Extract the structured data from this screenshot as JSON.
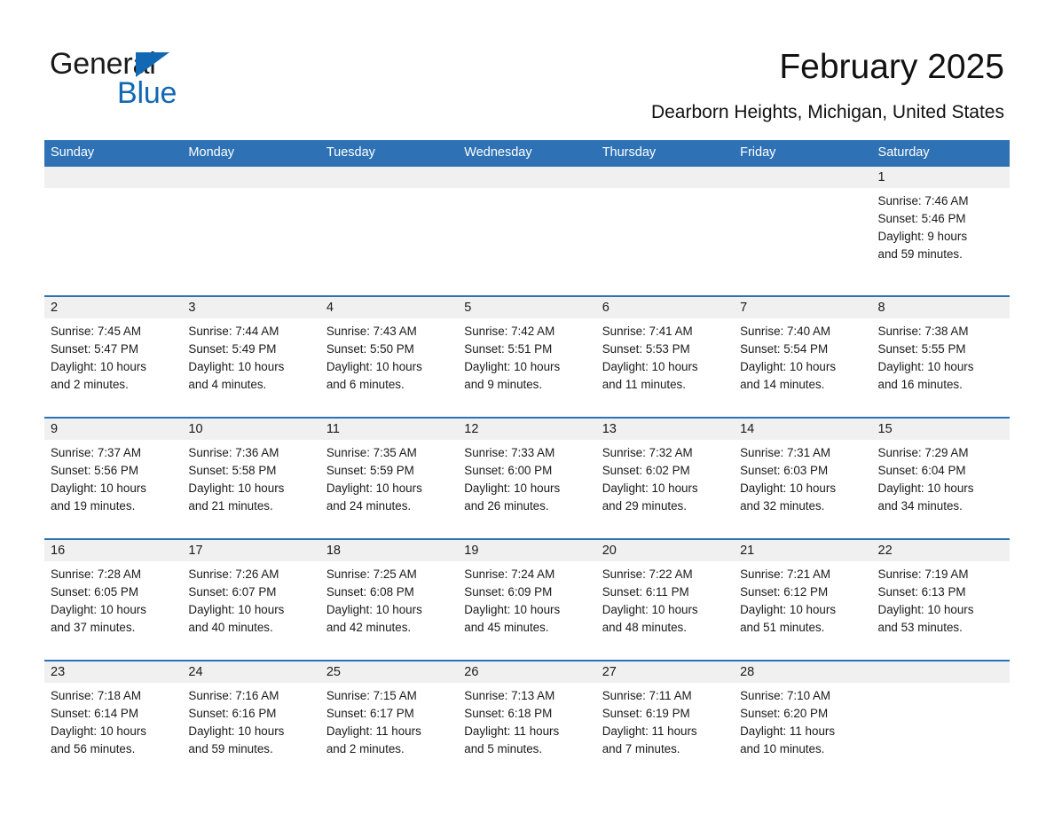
{
  "brand": {
    "name_part1": "General",
    "name_part2": "Blue",
    "triangle_color": "#1268b3"
  },
  "header": {
    "title": "February 2025",
    "subtitle": "Dearborn Heights, Michigan, United States",
    "accent_color": "#2e72b5",
    "band_color": "#f0f0f0"
  },
  "calendar": {
    "weekdays": [
      "Sunday",
      "Monday",
      "Tuesday",
      "Wednesday",
      "Thursday",
      "Friday",
      "Saturday"
    ],
    "weeks": [
      [
        {
          "day": "",
          "sunrise": "",
          "sunset": "",
          "daylight_line1": "",
          "daylight_line2": ""
        },
        {
          "day": "",
          "sunrise": "",
          "sunset": "",
          "daylight_line1": "",
          "daylight_line2": ""
        },
        {
          "day": "",
          "sunrise": "",
          "sunset": "",
          "daylight_line1": "",
          "daylight_line2": ""
        },
        {
          "day": "",
          "sunrise": "",
          "sunset": "",
          "daylight_line1": "",
          "daylight_line2": ""
        },
        {
          "day": "",
          "sunrise": "",
          "sunset": "",
          "daylight_line1": "",
          "daylight_line2": ""
        },
        {
          "day": "",
          "sunrise": "",
          "sunset": "",
          "daylight_line1": "",
          "daylight_line2": ""
        },
        {
          "day": "1",
          "sunrise": "Sunrise: 7:46 AM",
          "sunset": "Sunset: 5:46 PM",
          "daylight_line1": "Daylight: 9 hours",
          "daylight_line2": "and 59 minutes."
        }
      ],
      [
        {
          "day": "2",
          "sunrise": "Sunrise: 7:45 AM",
          "sunset": "Sunset: 5:47 PM",
          "daylight_line1": "Daylight: 10 hours",
          "daylight_line2": "and 2 minutes."
        },
        {
          "day": "3",
          "sunrise": "Sunrise: 7:44 AM",
          "sunset": "Sunset: 5:49 PM",
          "daylight_line1": "Daylight: 10 hours",
          "daylight_line2": "and 4 minutes."
        },
        {
          "day": "4",
          "sunrise": "Sunrise: 7:43 AM",
          "sunset": "Sunset: 5:50 PM",
          "daylight_line1": "Daylight: 10 hours",
          "daylight_line2": "and 6 minutes."
        },
        {
          "day": "5",
          "sunrise": "Sunrise: 7:42 AM",
          "sunset": "Sunset: 5:51 PM",
          "daylight_line1": "Daylight: 10 hours",
          "daylight_line2": "and 9 minutes."
        },
        {
          "day": "6",
          "sunrise": "Sunrise: 7:41 AM",
          "sunset": "Sunset: 5:53 PM",
          "daylight_line1": "Daylight: 10 hours",
          "daylight_line2": "and 11 minutes."
        },
        {
          "day": "7",
          "sunrise": "Sunrise: 7:40 AM",
          "sunset": "Sunset: 5:54 PM",
          "daylight_line1": "Daylight: 10 hours",
          "daylight_line2": "and 14 minutes."
        },
        {
          "day": "8",
          "sunrise": "Sunrise: 7:38 AM",
          "sunset": "Sunset: 5:55 PM",
          "daylight_line1": "Daylight: 10 hours",
          "daylight_line2": "and 16 minutes."
        }
      ],
      [
        {
          "day": "9",
          "sunrise": "Sunrise: 7:37 AM",
          "sunset": "Sunset: 5:56 PM",
          "daylight_line1": "Daylight: 10 hours",
          "daylight_line2": "and 19 minutes."
        },
        {
          "day": "10",
          "sunrise": "Sunrise: 7:36 AM",
          "sunset": "Sunset: 5:58 PM",
          "daylight_line1": "Daylight: 10 hours",
          "daylight_line2": "and 21 minutes."
        },
        {
          "day": "11",
          "sunrise": "Sunrise: 7:35 AM",
          "sunset": "Sunset: 5:59 PM",
          "daylight_line1": "Daylight: 10 hours",
          "daylight_line2": "and 24 minutes."
        },
        {
          "day": "12",
          "sunrise": "Sunrise: 7:33 AM",
          "sunset": "Sunset: 6:00 PM",
          "daylight_line1": "Daylight: 10 hours",
          "daylight_line2": "and 26 minutes."
        },
        {
          "day": "13",
          "sunrise": "Sunrise: 7:32 AM",
          "sunset": "Sunset: 6:02 PM",
          "daylight_line1": "Daylight: 10 hours",
          "daylight_line2": "and 29 minutes."
        },
        {
          "day": "14",
          "sunrise": "Sunrise: 7:31 AM",
          "sunset": "Sunset: 6:03 PM",
          "daylight_line1": "Daylight: 10 hours",
          "daylight_line2": "and 32 minutes."
        },
        {
          "day": "15",
          "sunrise": "Sunrise: 7:29 AM",
          "sunset": "Sunset: 6:04 PM",
          "daylight_line1": "Daylight: 10 hours",
          "daylight_line2": "and 34 minutes."
        }
      ],
      [
        {
          "day": "16",
          "sunrise": "Sunrise: 7:28 AM",
          "sunset": "Sunset: 6:05 PM",
          "daylight_line1": "Daylight: 10 hours",
          "daylight_line2": "and 37 minutes."
        },
        {
          "day": "17",
          "sunrise": "Sunrise: 7:26 AM",
          "sunset": "Sunset: 6:07 PM",
          "daylight_line1": "Daylight: 10 hours",
          "daylight_line2": "and 40 minutes."
        },
        {
          "day": "18",
          "sunrise": "Sunrise: 7:25 AM",
          "sunset": "Sunset: 6:08 PM",
          "daylight_line1": "Daylight: 10 hours",
          "daylight_line2": "and 42 minutes."
        },
        {
          "day": "19",
          "sunrise": "Sunrise: 7:24 AM",
          "sunset": "Sunset: 6:09 PM",
          "daylight_line1": "Daylight: 10 hours",
          "daylight_line2": "and 45 minutes."
        },
        {
          "day": "20",
          "sunrise": "Sunrise: 7:22 AM",
          "sunset": "Sunset: 6:11 PM",
          "daylight_line1": "Daylight: 10 hours",
          "daylight_line2": "and 48 minutes."
        },
        {
          "day": "21",
          "sunrise": "Sunrise: 7:21 AM",
          "sunset": "Sunset: 6:12 PM",
          "daylight_line1": "Daylight: 10 hours",
          "daylight_line2": "and 51 minutes."
        },
        {
          "day": "22",
          "sunrise": "Sunrise: 7:19 AM",
          "sunset": "Sunset: 6:13 PM",
          "daylight_line1": "Daylight: 10 hours",
          "daylight_line2": "and 53 minutes."
        }
      ],
      [
        {
          "day": "23",
          "sunrise": "Sunrise: 7:18 AM",
          "sunset": "Sunset: 6:14 PM",
          "daylight_line1": "Daylight: 10 hours",
          "daylight_line2": "and 56 minutes."
        },
        {
          "day": "24",
          "sunrise": "Sunrise: 7:16 AM",
          "sunset": "Sunset: 6:16 PM",
          "daylight_line1": "Daylight: 10 hours",
          "daylight_line2": "and 59 minutes."
        },
        {
          "day": "25",
          "sunrise": "Sunrise: 7:15 AM",
          "sunset": "Sunset: 6:17 PM",
          "daylight_line1": "Daylight: 11 hours",
          "daylight_line2": "and 2 minutes."
        },
        {
          "day": "26",
          "sunrise": "Sunrise: 7:13 AM",
          "sunset": "Sunset: 6:18 PM",
          "daylight_line1": "Daylight: 11 hours",
          "daylight_line2": "and 5 minutes."
        },
        {
          "day": "27",
          "sunrise": "Sunrise: 7:11 AM",
          "sunset": "Sunset: 6:19 PM",
          "daylight_line1": "Daylight: 11 hours",
          "daylight_line2": "and 7 minutes."
        },
        {
          "day": "28",
          "sunrise": "Sunrise: 7:10 AM",
          "sunset": "Sunset: 6:20 PM",
          "daylight_line1": "Daylight: 11 hours",
          "daylight_line2": "and 10 minutes."
        },
        {
          "day": "",
          "sunrise": "",
          "sunset": "",
          "daylight_line1": "",
          "daylight_line2": ""
        }
      ]
    ]
  }
}
